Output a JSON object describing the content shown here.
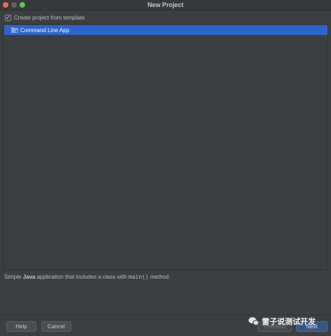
{
  "window": {
    "title": "New Project"
  },
  "template_option": {
    "label": "Create project from template",
    "checked": true
  },
  "templates": [
    {
      "label": "Command Line App",
      "selected": true
    }
  ],
  "description": {
    "prefix": "Simple ",
    "bold": "Java",
    "middle": " application that includes a class with ",
    "code": "main()",
    "suffix": " method"
  },
  "buttons": {
    "help": "Help",
    "cancel": "Cancel",
    "previous": "Previous",
    "next": "Next"
  },
  "watermark": {
    "text": "雷子说测试开发",
    "icon": "wechat-icon"
  },
  "colors": {
    "selection": "#2f65ca",
    "background": "#3c3f41",
    "primary_button": "#365880"
  }
}
